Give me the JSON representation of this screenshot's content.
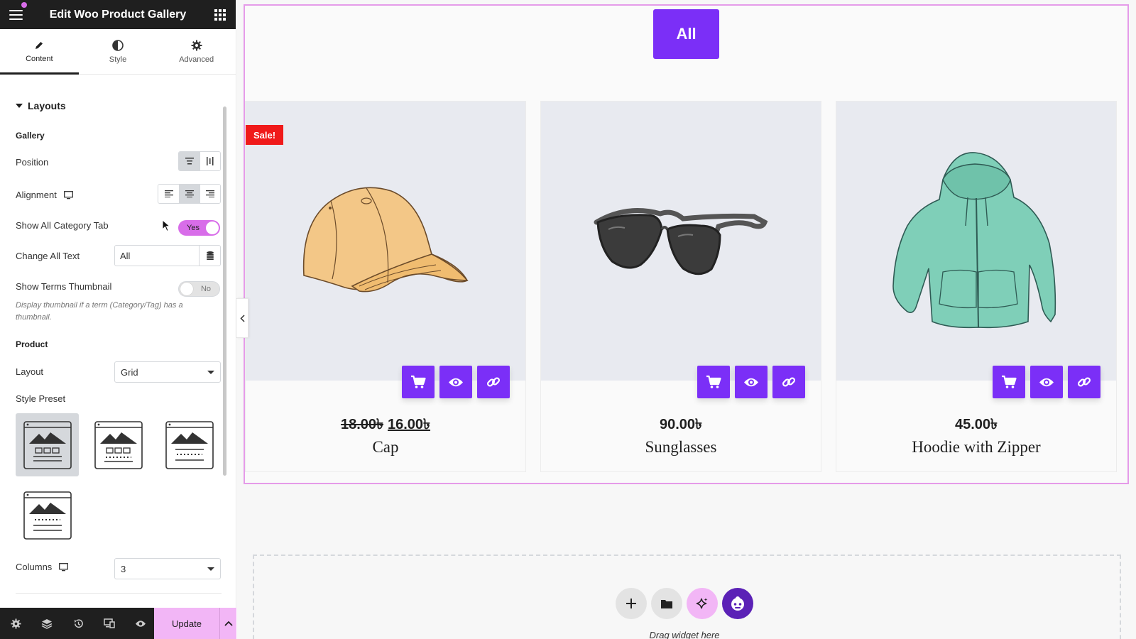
{
  "editor": {
    "title": "Edit Woo Product Gallery",
    "tabs": [
      {
        "label": "Content",
        "icon": "pencil-icon"
      },
      {
        "label": "Style",
        "icon": "half-circle-icon"
      },
      {
        "label": "Advanced",
        "icon": "gear-icon"
      }
    ],
    "active_tab": "Content"
  },
  "panel": {
    "section_title": "Layouts",
    "gallery_heading": "Gallery",
    "position_label": "Position",
    "alignment_label": "Alignment",
    "show_all_tab_label": "Show All Category Tab",
    "show_all_tab_value": "Yes",
    "change_all_text_label": "Change All Text",
    "change_all_text_value": "All",
    "show_terms_thumb_label": "Show Terms Thumbnail",
    "show_terms_thumb_value": "No",
    "show_terms_thumb_desc": "Display thumbnail if a term (Category/Tag) has a thumbnail.",
    "product_heading": "Product",
    "layout_label": "Layout",
    "layout_value": "Grid",
    "style_preset_label": "Style Preset",
    "columns_label": "Columns",
    "columns_value": "3"
  },
  "footer": {
    "update_label": "Update"
  },
  "canvas": {
    "filter_tab": "All",
    "products": [
      {
        "name": "Cap",
        "old_price": "18.00৳",
        "price": "16.00৳",
        "sale_badge": "Sale!",
        "image": "cap-image"
      },
      {
        "name": "Sunglasses",
        "price": "90.00৳",
        "image": "sunglasses-image"
      },
      {
        "name": "Hoodie with Zipper",
        "price": "45.00৳",
        "image": "hoodie-image"
      }
    ],
    "drop_text": "Drag widget here"
  },
  "colors": {
    "accent": "#7b2ff7",
    "toggle_on": "#d86de9",
    "update_bg": "#f2b6f6",
    "sale": "#f01a1a",
    "editor_dark": "#1f1f1f"
  }
}
